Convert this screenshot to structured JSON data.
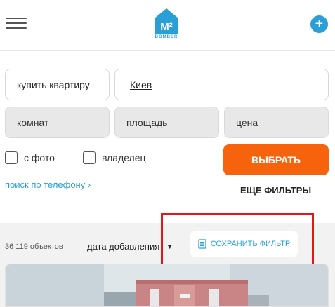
{
  "header": {
    "menu_icon": "hamburger-icon",
    "logo_text": "M²",
    "logo_sub": "BOMBER",
    "add_icon": "plus-icon",
    "add_label": "+"
  },
  "search": {
    "deal_type": "купить квартиру",
    "city": "Киев",
    "rooms_placeholder": "комнат",
    "area_placeholder": "площадь",
    "price_placeholder": "цена",
    "with_photo_label": "с фото",
    "owner_label": "владелец",
    "choose_button": "ВЫБРАТЬ",
    "phone_search_link": "поиск по телефону ›",
    "more_filters": "ЕЩЕ ФИЛЬТРЫ"
  },
  "results": {
    "count": "36 119 объектов",
    "sort_label": "дата добавления",
    "save_filter": "СОХРАНИТЬ ФИЛЬТР"
  },
  "colors": {
    "accent_blue": "#2a9fd6",
    "button_orange": "#f7630c",
    "highlight_red": "#e8141b"
  }
}
